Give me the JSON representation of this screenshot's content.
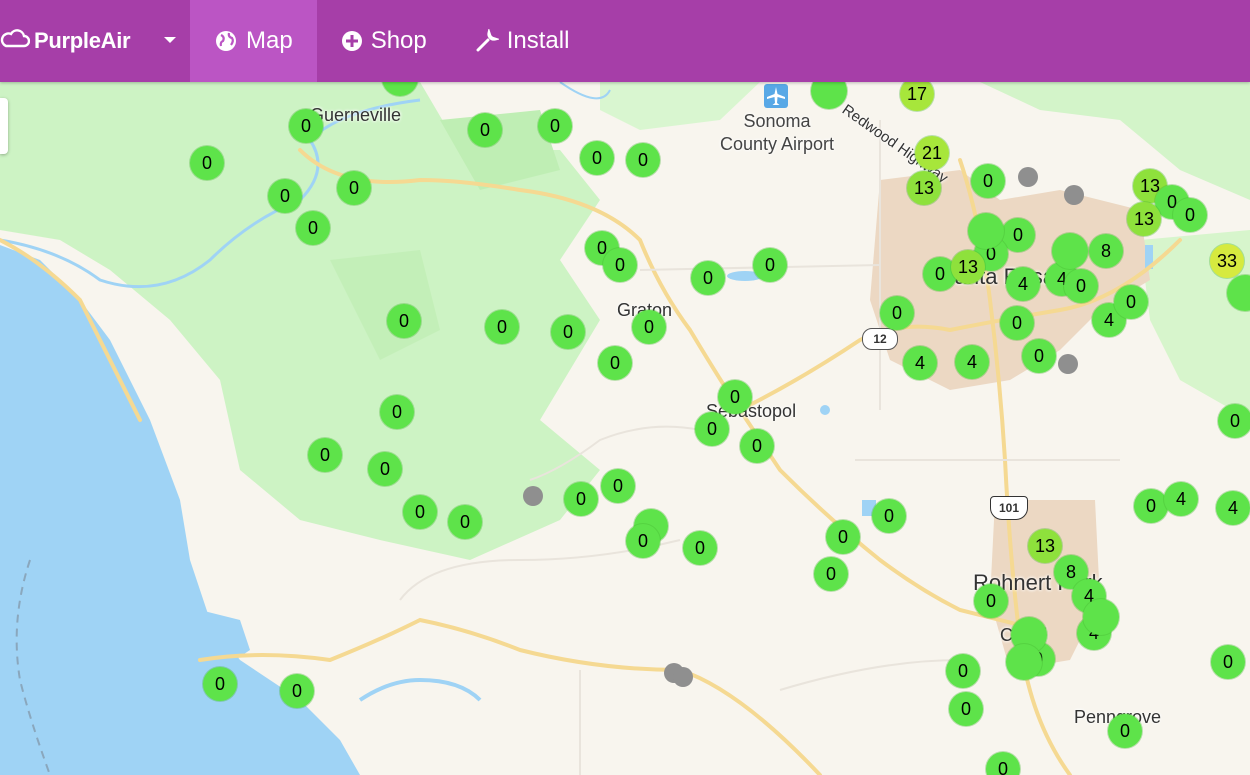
{
  "navbar": {
    "brand": "PurpleAir",
    "items": [
      {
        "label": "Map",
        "icon": "globe-icon",
        "active": true
      },
      {
        "label": "Shop",
        "icon": "plus-circle-icon",
        "active": false
      },
      {
        "label": "Install",
        "icon": "wrench-icon",
        "active": false
      }
    ],
    "background": "#a63ea8",
    "active_background": "#bb55c4"
  },
  "map": {
    "places": [
      "Guerneville",
      "Graton",
      "Sebastopol",
      "Santa Rosa",
      "Rohnert Park",
      "Cotati",
      "Penngrove"
    ],
    "airport": {
      "line1": "Sonoma",
      "line2": "County Airport"
    },
    "road_label": "Redwood Highway",
    "shields": [
      "12",
      "101"
    ],
    "sensor_values": [
      "17",
      "21",
      "13",
      "0",
      "13",
      "0",
      "0",
      "13",
      "33",
      "8",
      "0",
      "4",
      "4",
      "0",
      "4",
      "0",
      "0",
      "0",
      "0",
      "4",
      "4",
      "13",
      "8",
      "4",
      "4",
      "0",
      "4",
      "0",
      "4"
    ],
    "colors": {
      "good": "#5ee34a",
      "moderate_low": "#a7e63b",
      "moderate": "#d6ea3f",
      "offline": "#8f8f8f",
      "water": "#9fd3f5",
      "park": "#cdf3c4"
    }
  }
}
